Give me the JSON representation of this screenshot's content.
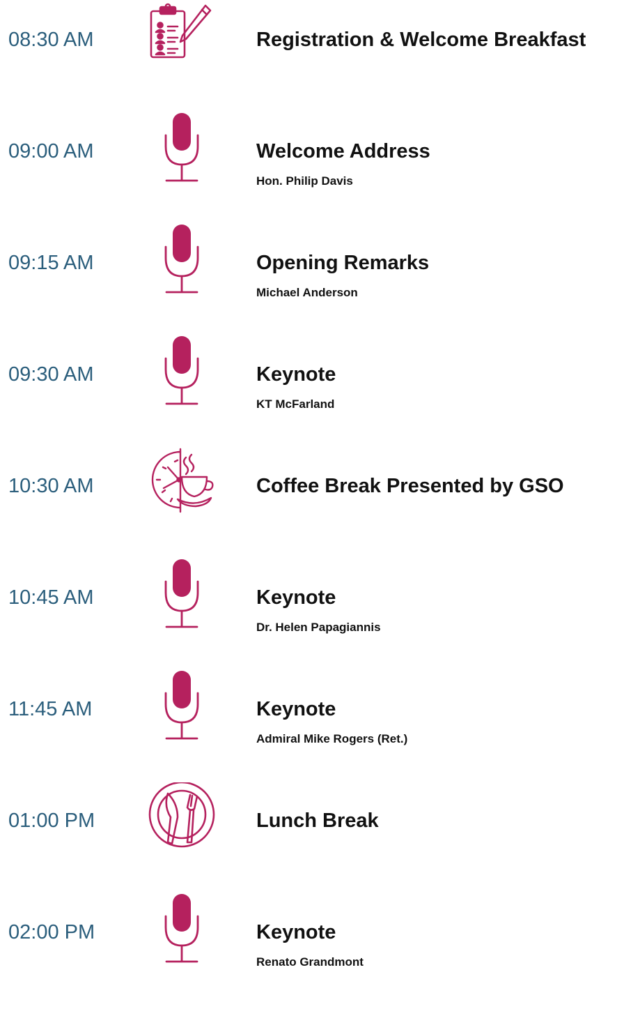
{
  "colors": {
    "accent": "#b5215e",
    "time": "#2b5e7c",
    "text": "#111111"
  },
  "agenda": [
    {
      "time": "08:30 AM",
      "icon": "clipboard-pen-icon",
      "title": "Registration & Welcome Breakfast",
      "speaker": ""
    },
    {
      "time": "09:00 AM",
      "icon": "microphone-icon",
      "title": "Welcome Address",
      "speaker": "Hon. Philip Davis"
    },
    {
      "time": "09:15 AM",
      "icon": "microphone-icon",
      "title": "Opening Remarks",
      "speaker": "Michael Anderson"
    },
    {
      "time": "09:30 AM",
      "icon": "microphone-icon",
      "title": "Keynote",
      "speaker": "KT McFarland"
    },
    {
      "time": "10:30 AM",
      "icon": "clock-coffee-icon",
      "title": "Coffee Break Presented by GSO",
      "speaker": ""
    },
    {
      "time": "10:45 AM",
      "icon": "microphone-icon",
      "title": "Keynote",
      "speaker": "Dr. Helen Papagiannis"
    },
    {
      "time": "11:45 AM",
      "icon": "microphone-icon",
      "title": "Keynote",
      "speaker": "Admiral Mike Rogers (Ret.)"
    },
    {
      "time": "01:00 PM",
      "icon": "plate-cutlery-icon",
      "title": "Lunch Break",
      "speaker": ""
    },
    {
      "time": "02:00 PM",
      "icon": "microphone-icon",
      "title": "Keynote",
      "speaker": "Renato Grandmont"
    }
  ]
}
